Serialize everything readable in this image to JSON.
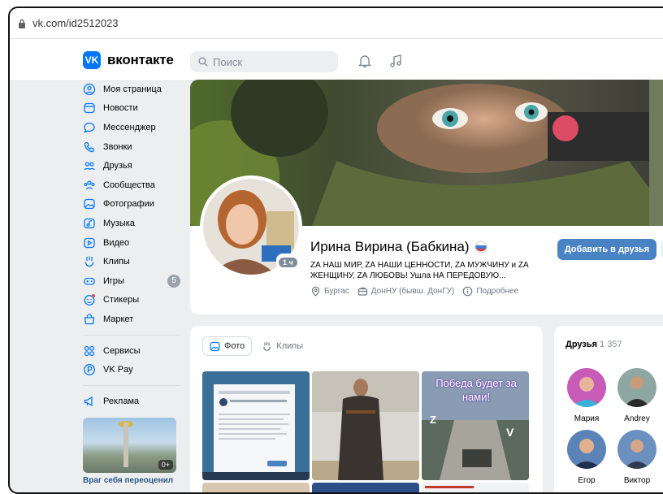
{
  "browser": {
    "url": "vk.com/id2512023"
  },
  "header": {
    "logo_text": "вконтакте",
    "logo_badge": "VK",
    "search_placeholder": "Поиск"
  },
  "sidebar": {
    "items": [
      {
        "label": "Моя страница",
        "icon": "user-circle-icon"
      },
      {
        "label": "Новости",
        "icon": "news-icon"
      },
      {
        "label": "Мессенджер",
        "icon": "message-icon"
      },
      {
        "label": "Звонки",
        "icon": "phone-icon"
      },
      {
        "label": "Друзья",
        "icon": "friends-icon"
      },
      {
        "label": "Сообщества",
        "icon": "communities-icon"
      },
      {
        "label": "Фотографии",
        "icon": "photos-icon"
      },
      {
        "label": "Музыка",
        "icon": "music-icon"
      },
      {
        "label": "Видео",
        "icon": "video-icon"
      },
      {
        "label": "Клипы",
        "icon": "clips-icon"
      },
      {
        "label": "Игры",
        "icon": "games-icon",
        "badge": "5"
      },
      {
        "label": "Стикеры",
        "icon": "stickers-icon"
      },
      {
        "label": "Маркет",
        "icon": "market-icon"
      }
    ],
    "extra": [
      {
        "label": "Сервисы",
        "icon": "services-icon"
      },
      {
        "label": "VK Pay",
        "icon": "vkpay-icon"
      }
    ],
    "ads": {
      "label": "Реклама",
      "icon": "ads-icon"
    },
    "promo": {
      "badge": "0+",
      "caption": "Враг себя переоценил"
    }
  },
  "profile": {
    "name": "Ирина Вирина (Бабкина)",
    "status": "ZА НАШ МИР, ZА НАШИ ЦЕННОСТИ, ZА МУЖЧИНУ и ZА ЖЕНЩИНУ, ZА ЛЮБОВЬ! Ушла НА ПЕРЕДОВУЮ...",
    "online": "1 ч",
    "city": "Бургас",
    "education": "ДонНУ (бывш. ДонГУ)",
    "more": "Подробнее",
    "add_friend": "Добавить в друзья"
  },
  "media": {
    "tabs": [
      {
        "label": "Фото",
        "active": true
      },
      {
        "label": "Клипы",
        "active": false
      }
    ],
    "slogan": "Победа будет за нами!"
  },
  "friends": {
    "title": "Друзья",
    "count": "1 357",
    "list": [
      {
        "name": "Мария"
      },
      {
        "name": "Andrey"
      },
      {
        "name": "Егор"
      },
      {
        "name": "Виктор"
      }
    ]
  },
  "colors": {
    "accent": "#0077ff",
    "button": "#4a83c4",
    "link": "#2a5885"
  }
}
